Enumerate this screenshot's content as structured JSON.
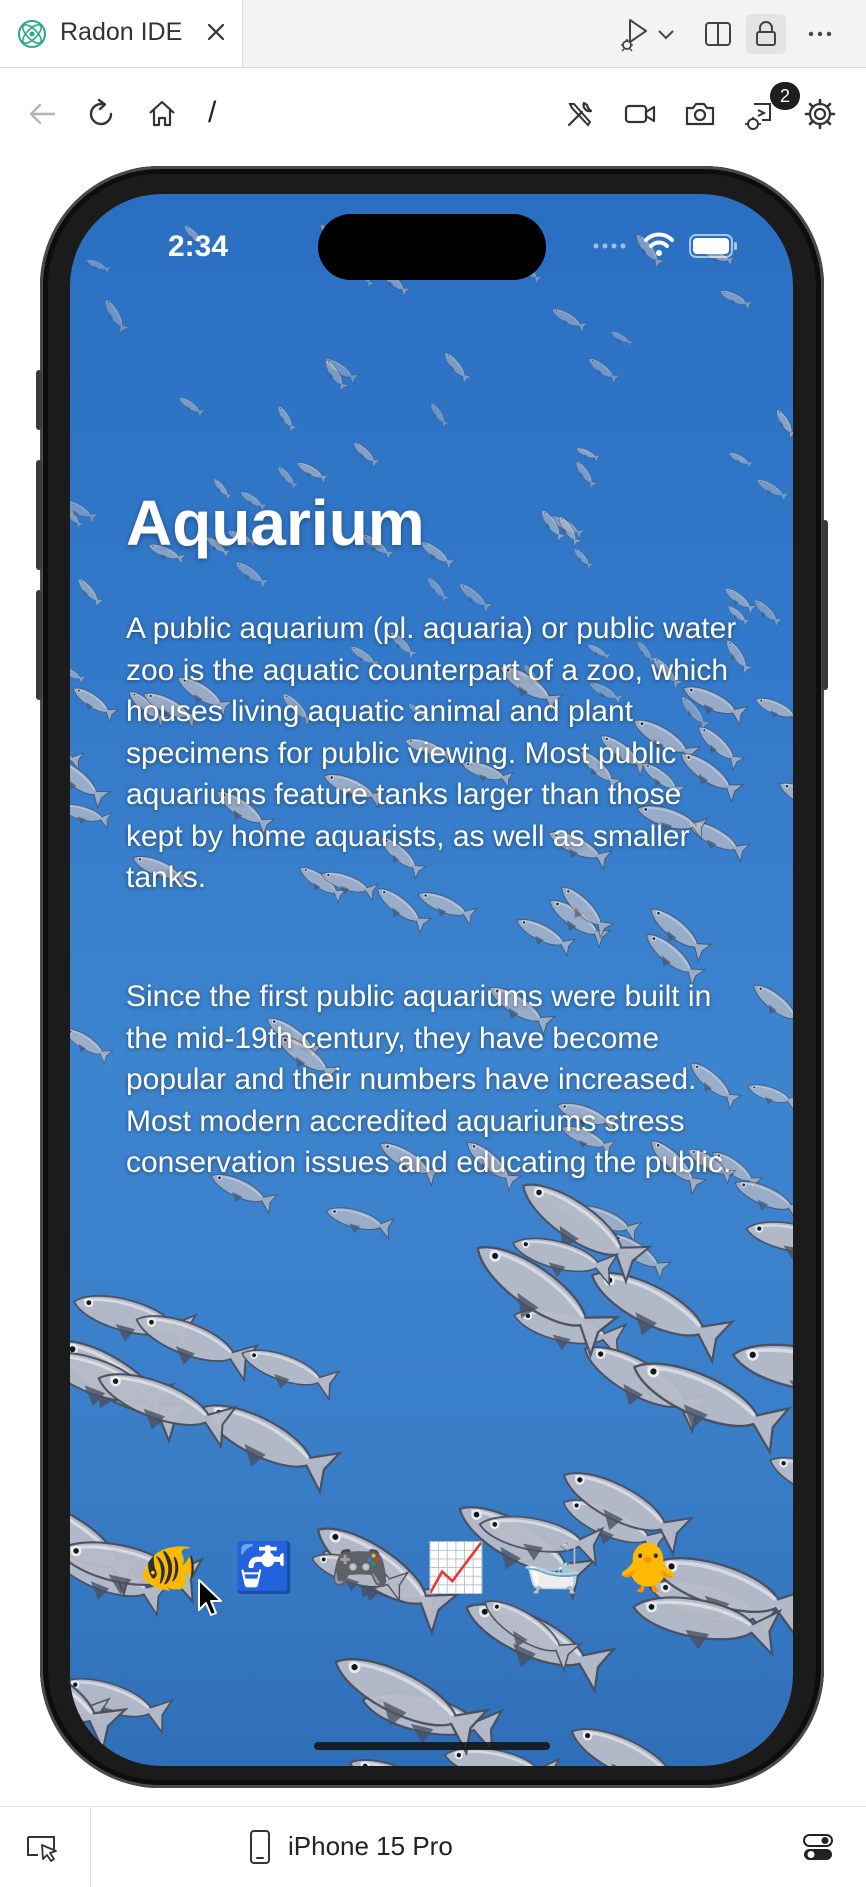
{
  "tab": {
    "title": "Radon IDE"
  },
  "toolbar": {
    "path": "/",
    "debug_badge_count": "2"
  },
  "statusbar": {
    "time": "2:34"
  },
  "app": {
    "title": "Aquarium",
    "paragraph1": "A public aquarium (pl. aquaria) or public water zoo is the aquatic counterpart of a zoo, which houses living aquatic animal and plant specimens for public viewing. Most public aquariums feature tanks larger than those kept by home aquarists, as well as smaller tanks.",
    "paragraph2": "Since the first public aquariums were built in the mid-19th century, they have become popular and their numbers have increased. Most modern accredited aquariums stress conservation issues and educating the public.",
    "emojis": [
      "🐠",
      "🚰",
      "🎮",
      "📈",
      "🛁",
      "🐥"
    ]
  },
  "bottombar": {
    "device": "iPhone 15 Pro"
  },
  "colors": {
    "water": "#3379c9",
    "fish_body": "#b8bcc8",
    "fish_dark": "#4a4f5e",
    "accent": "#1e1e1e"
  },
  "icons": {
    "tab": [
      "radon-logo-icon",
      "close-icon"
    ],
    "tab_toolbar": [
      "run-debug-icon",
      "chevron-down-icon",
      "split-editor-icon",
      "lock-icon",
      "more-icon"
    ],
    "toolbar": [
      "back-arrow-icon",
      "reload-icon",
      "home-icon",
      "tools-icon",
      "record-video-icon",
      "camera-icon",
      "debug-icon",
      "gear-icon"
    ],
    "bottombar": [
      "inspect-icon",
      "phone-icon",
      "toggles-icon"
    ]
  }
}
